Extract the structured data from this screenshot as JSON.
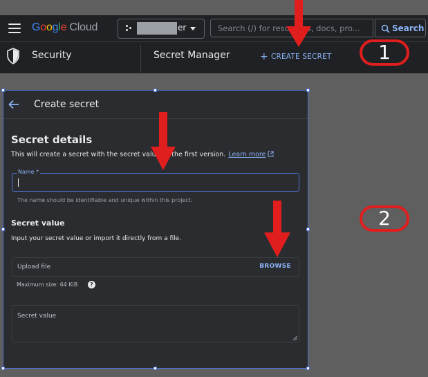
{
  "header": {
    "logo_google": [
      "G",
      "o",
      "o",
      "g",
      "l",
      "e"
    ],
    "logo_cloud": "Cloud",
    "project_suffix": "er",
    "search_placeholder": "Search (/) for resources, docs, pro...",
    "search_button": "Search"
  },
  "subheader": {
    "product": "Security",
    "page": "Secret Manager",
    "create_button": "CREATE SECRET"
  },
  "callouts": {
    "one": "1",
    "two": "2"
  },
  "panel": {
    "title": "Create secret",
    "section_title": "Secret details",
    "section_desc": "This will create a secret with the secret value as the first version.",
    "learn_more": "Learn more",
    "name_label": "Name *",
    "name_value": "",
    "name_help": "The name should be identifiable and unique within this project.",
    "secret_value_title": "Secret value",
    "secret_value_desc": "Input your secret value or import it directly from a file.",
    "upload_label": "Upload file",
    "browse_button": "BROWSE",
    "max_size": "Maximum size: 64 KiB",
    "help_glyph": "?",
    "secret_value_placeholder": "Secret value"
  },
  "colors": {
    "accent": "#8ab4f8",
    "annotation_red": "#e01e1e",
    "focus_blue": "#4f72d6"
  },
  "icons": {
    "menu": "hamburger-icon",
    "shield": "shield-icon",
    "back": "arrow-left-icon",
    "search": "search-icon",
    "external": "external-link-icon",
    "help": "help-icon"
  }
}
